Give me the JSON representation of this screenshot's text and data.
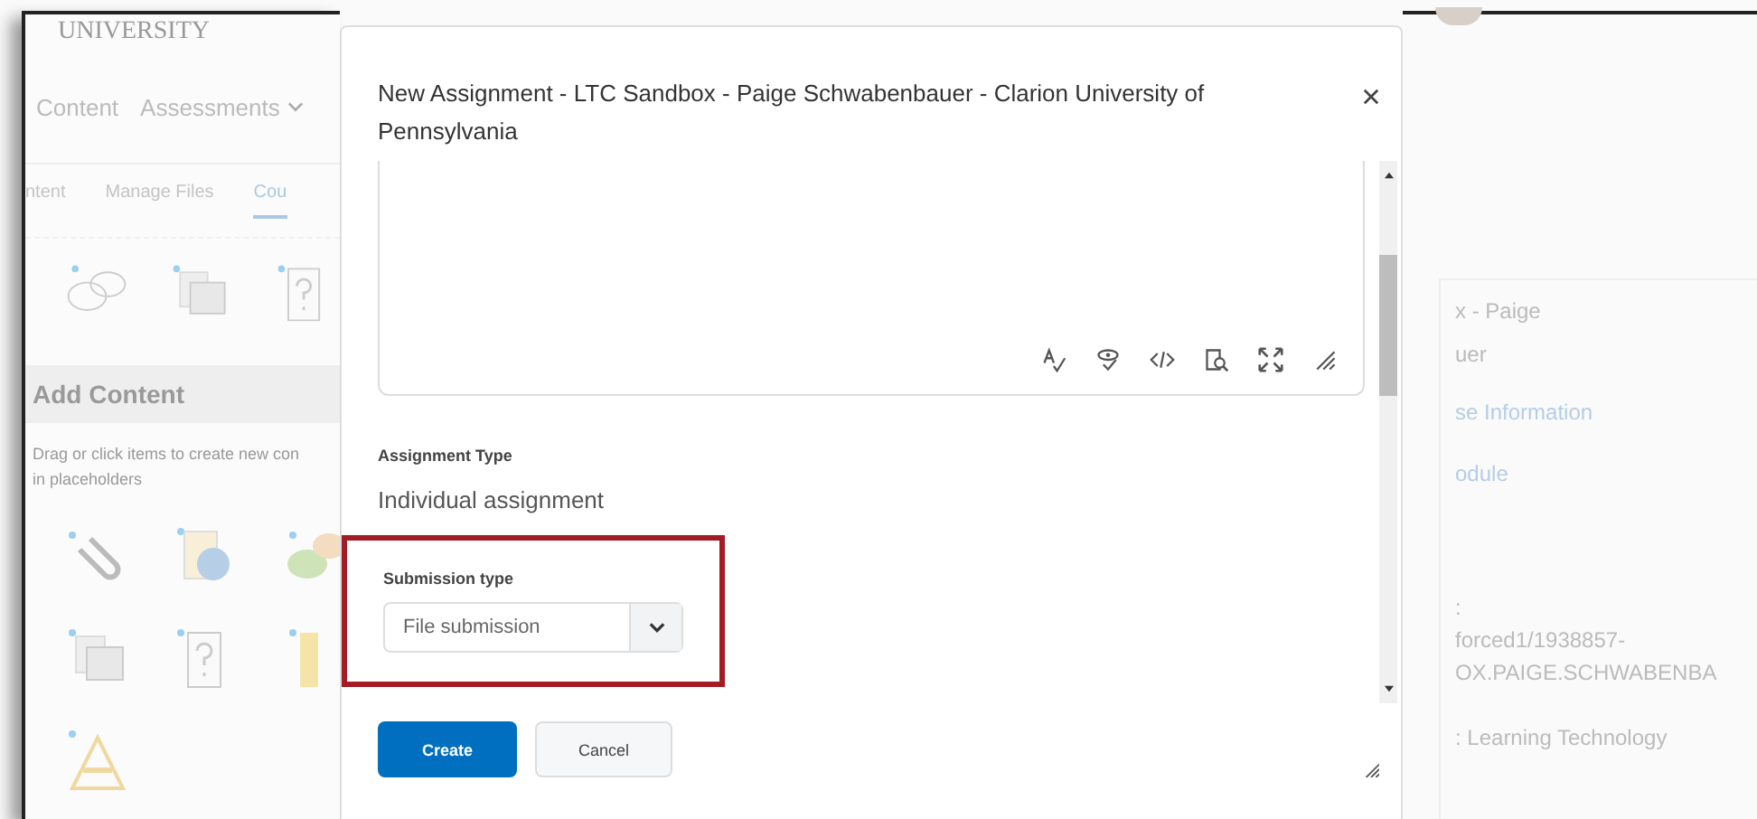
{
  "background_page": {
    "header_text": "UNIVERSITY",
    "nav": [
      {
        "label": "Content",
        "dropdown": false
      },
      {
        "label": "Assessments",
        "dropdown": true
      }
    ],
    "tabs": [
      {
        "label": "ntent",
        "selected": false
      },
      {
        "label": "Manage Files",
        "selected": false
      },
      {
        "label": "Cou",
        "selected": true
      }
    ],
    "add_content": {
      "title": "Add Content",
      "description_lines": [
        "Drag or click items to create new con",
        "in placeholders"
      ]
    },
    "side_panel": [
      {
        "text": "x - Paige",
        "kind": "text"
      },
      {
        "text": "uer",
        "kind": "text"
      },
      {
        "text": "se Information",
        "kind": "link"
      },
      {
        "text": "odule",
        "kind": "link"
      },
      {
        "text": ":",
        "kind": "text"
      },
      {
        "text": "forced1/1938857-",
        "kind": "text"
      },
      {
        "text": "OX.PAIGE.SCHWABENBA",
        "kind": "text"
      },
      {
        "text": ": Learning Technology",
        "kind": "text"
      }
    ]
  },
  "dialog": {
    "title": "New Assignment - LTC Sandbox - Paige Schwabenbauer - Clarion University of Pennsylvania",
    "assignment_type": {
      "label": "Assignment Type",
      "value": "Individual assignment"
    },
    "submission_type": {
      "label": "Submission type",
      "value": "File submission",
      "highlighted": true
    },
    "buttons": [
      {
        "label": "Create",
        "kind": "primary"
      },
      {
        "label": "Cancel",
        "kind": "secondary"
      }
    ]
  }
}
